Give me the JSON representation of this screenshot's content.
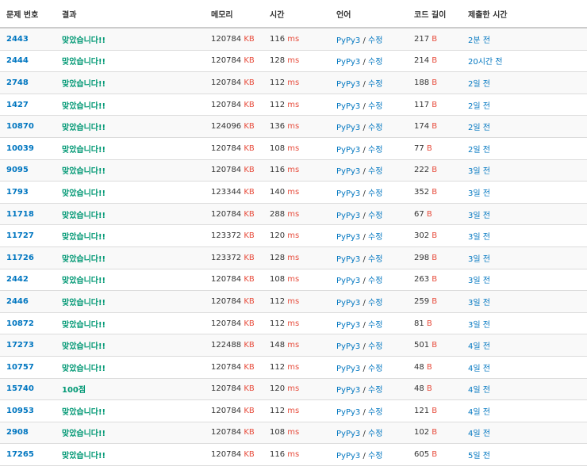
{
  "headers": {
    "problem": "문제 번호",
    "result": "결과",
    "memory": "메모리",
    "time": "시간",
    "language": "언어",
    "code_length": "코드 길이",
    "submitted": "제출한 시간"
  },
  "units": {
    "memory": "KB",
    "time": "ms",
    "length": "B"
  },
  "edit_label": "수정",
  "accent_colors": {
    "link": "#0076c0",
    "accepted": "#009874",
    "unit": "#e74c3c"
  },
  "rows": [
    {
      "problem": "2443",
      "result": "맞았습니다!!",
      "memory": "120784",
      "time": "116",
      "language": "PyPy3",
      "length": "217",
      "submitted": "2분 전"
    },
    {
      "problem": "2444",
      "result": "맞았습니다!!",
      "memory": "120784",
      "time": "128",
      "language": "PyPy3",
      "length": "214",
      "submitted": "20시간 전"
    },
    {
      "problem": "2748",
      "result": "맞았습니다!!",
      "memory": "120784",
      "time": "112",
      "language": "PyPy3",
      "length": "188",
      "submitted": "2일 전"
    },
    {
      "problem": "1427",
      "result": "맞았습니다!!",
      "memory": "120784",
      "time": "112",
      "language": "PyPy3",
      "length": "117",
      "submitted": "2일 전"
    },
    {
      "problem": "10870",
      "result": "맞았습니다!!",
      "memory": "124096",
      "time": "136",
      "language": "PyPy3",
      "length": "174",
      "submitted": "2일 전"
    },
    {
      "problem": "10039",
      "result": "맞았습니다!!",
      "memory": "120784",
      "time": "108",
      "language": "PyPy3",
      "length": "77",
      "submitted": "2일 전"
    },
    {
      "problem": "9095",
      "result": "맞았습니다!!",
      "memory": "120784",
      "time": "116",
      "language": "PyPy3",
      "length": "222",
      "submitted": "3일 전"
    },
    {
      "problem": "1793",
      "result": "맞았습니다!!",
      "memory": "123344",
      "time": "140",
      "language": "PyPy3",
      "length": "352",
      "submitted": "3일 전"
    },
    {
      "problem": "11718",
      "result": "맞았습니다!!",
      "memory": "120784",
      "time": "288",
      "language": "PyPy3",
      "length": "67",
      "submitted": "3일 전"
    },
    {
      "problem": "11727",
      "result": "맞았습니다!!",
      "memory": "123372",
      "time": "120",
      "language": "PyPy3",
      "length": "302",
      "submitted": "3일 전"
    },
    {
      "problem": "11726",
      "result": "맞았습니다!!",
      "memory": "123372",
      "time": "128",
      "language": "PyPy3",
      "length": "298",
      "submitted": "3일 전"
    },
    {
      "problem": "2442",
      "result": "맞았습니다!!",
      "memory": "120784",
      "time": "108",
      "language": "PyPy3",
      "length": "263",
      "submitted": "3일 전"
    },
    {
      "problem": "2446",
      "result": "맞았습니다!!",
      "memory": "120784",
      "time": "112",
      "language": "PyPy3",
      "length": "259",
      "submitted": "3일 전"
    },
    {
      "problem": "10872",
      "result": "맞았습니다!!",
      "memory": "120784",
      "time": "112",
      "language": "PyPy3",
      "length": "81",
      "submitted": "3일 전"
    },
    {
      "problem": "17273",
      "result": "맞았습니다!!",
      "memory": "122488",
      "time": "148",
      "language": "PyPy3",
      "length": "501",
      "submitted": "4일 전"
    },
    {
      "problem": "10757",
      "result": "맞았습니다!!",
      "memory": "120784",
      "time": "112",
      "language": "PyPy3",
      "length": "48",
      "submitted": "4일 전"
    },
    {
      "problem": "15740",
      "result": "100점",
      "memory": "120784",
      "time": "120",
      "language": "PyPy3",
      "length": "48",
      "submitted": "4일 전"
    },
    {
      "problem": "10953",
      "result": "맞았습니다!!",
      "memory": "120784",
      "time": "112",
      "language": "PyPy3",
      "length": "121",
      "submitted": "4일 전"
    },
    {
      "problem": "2908",
      "result": "맞았습니다!!",
      "memory": "120784",
      "time": "108",
      "language": "PyPy3",
      "length": "102",
      "submitted": "4일 전"
    },
    {
      "problem": "17265",
      "result": "맞았습니다!!",
      "memory": "120784",
      "time": "116",
      "language": "PyPy3",
      "length": "605",
      "submitted": "5일 전"
    }
  ]
}
